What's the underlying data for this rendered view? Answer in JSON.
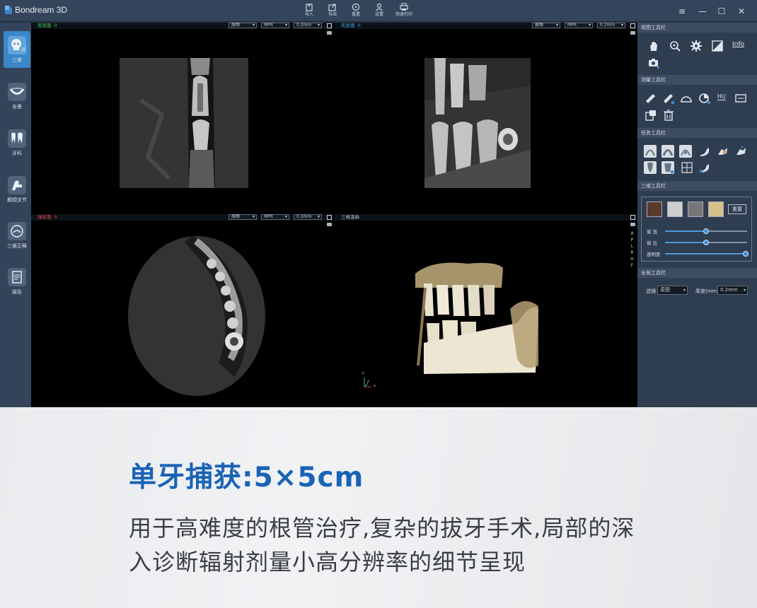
{
  "app": {
    "title": "Bondream 3D",
    "accent": "#3c87c8"
  },
  "toolbar": [
    {
      "label": "导入",
      "icon": "import-icon"
    },
    {
      "label": "导出",
      "icon": "export-icon"
    },
    {
      "label": "重置",
      "icon": "reset-icon"
    },
    {
      "label": "设置",
      "icon": "settings-icon"
    },
    {
      "label": "快速打印",
      "icon": "print-icon"
    }
  ],
  "window_controls": {
    "menu": "≡",
    "minimize": "—",
    "maximize": "☐",
    "close": "✕"
  },
  "sidebar": [
    {
      "label": "三维",
      "icon": "skull-3d-icon",
      "active": true
    },
    {
      "label": "全景",
      "icon": "arch-panorama-icon",
      "active": false
    },
    {
      "label": "牙科",
      "icon": "tooth-icon",
      "active": false
    },
    {
      "label": "颞颌关节",
      "icon": "jaw-joint-icon",
      "active": false
    },
    {
      "label": "三维正畸",
      "icon": "orthodontic-icon",
      "active": false
    },
    {
      "label": "报告",
      "icon": "report-icon",
      "active": false
    }
  ],
  "viewports": {
    "coronal": {
      "title": "冠状面",
      "index": "0",
      "color": "#3fcf5a",
      "mode": "原图",
      "render": "MPR",
      "thickness": "0.2mm"
    },
    "sagittal": {
      "title": "矢状面",
      "index": "0",
      "color": "#3aa6e8",
      "mode": "原图",
      "render": "MPR",
      "thickness": "0.2mm"
    },
    "axial": {
      "title": "轴状面",
      "index": "0",
      "color": "#e04848",
      "mode": "原图",
      "render": "MPR",
      "thickness": "0.2mm"
    },
    "render3d": {
      "title": "三维渲染",
      "color": "#c9d1da",
      "orientation": [
        "A",
        "P",
        "L",
        "R",
        "H",
        "F"
      ],
      "axes": {
        "x": "x",
        "y": "y",
        "z": "z"
      }
    }
  },
  "right_panel": {
    "view_toolbar": {
      "title": "视图工具栏",
      "info_label": "Info"
    },
    "measure_toolbar": {
      "title": "测量工具栏",
      "hu_label": "HU"
    },
    "task_toolbar": {
      "title": "任务工具栏"
    },
    "render_toolbar": {
      "title": "三维工具栏",
      "reset_label": "重置",
      "sliders": [
        {
          "label": "窗 宽",
          "value": 0.5
        },
        {
          "label": "窗 位",
          "value": 0.5
        },
        {
          "label": "透明度",
          "value": 0.98
        }
      ]
    },
    "global_toolbar": {
      "title": "全局工具栏",
      "filter_label": "滤镜",
      "filter_value": "原图",
      "thickness_label": "厚度(mm)",
      "thickness_value": "0.2mm"
    }
  },
  "banner": {
    "title": "单牙捕获:5×5cm",
    "desc_line1": "用于高难度的根管治疗,复杂的拔牙手术,局部的深",
    "desc_line2": "入诊断辐射剂量小高分辨率的细节呈现",
    "title_color": "#1a63b6"
  }
}
